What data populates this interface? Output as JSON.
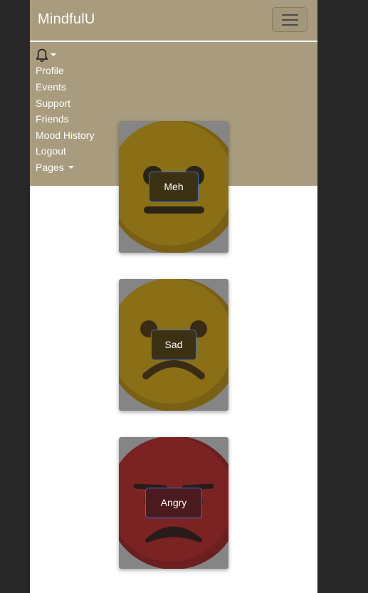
{
  "navbar": {
    "brand": "MindfulU",
    "bg_color": "#a99c7e",
    "toggler_icon": "hamburger-menu-icon",
    "notification_icon": "bell-icon",
    "links": [
      "Profile",
      "Events",
      "Support",
      "Friends",
      "Mood History",
      "Logout"
    ],
    "pages_dropdown": "Pages"
  },
  "moods": [
    {
      "label": "Meh",
      "face_color": "#8a6f17",
      "icon": "neutral-face-icon"
    },
    {
      "label": "Sad",
      "face_color": "#8a6f17",
      "icon": "sad-face-icon"
    },
    {
      "label": "Angry",
      "face_color": "#7b2323",
      "icon": "angry-face-icon"
    }
  ]
}
